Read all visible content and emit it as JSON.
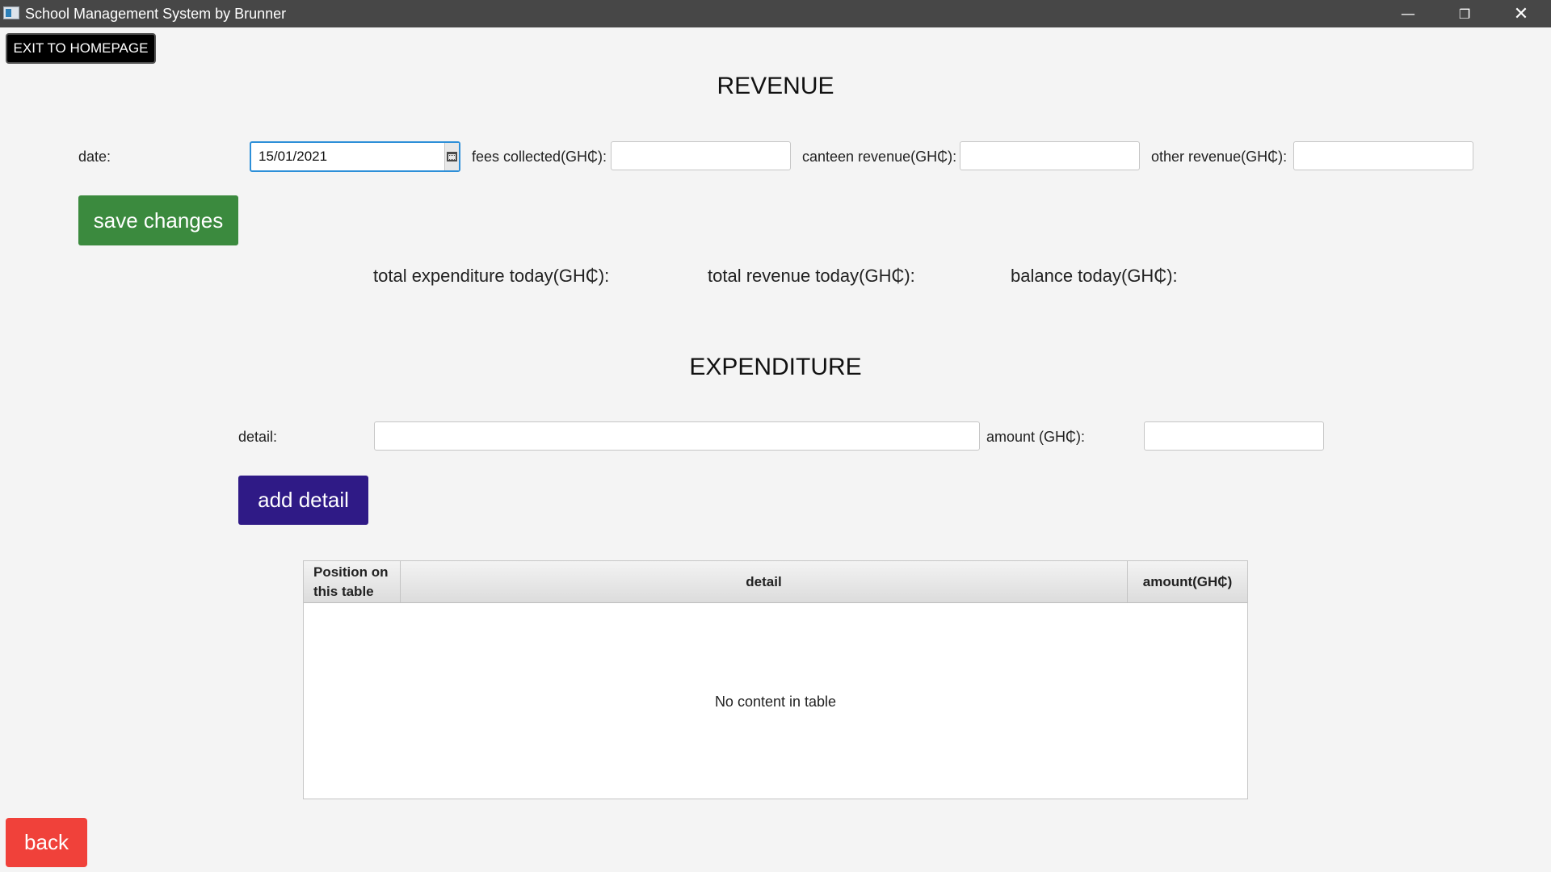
{
  "window": {
    "title": "School Management System by Brunner",
    "minimize_glyph": "—",
    "maximize_glyph": "❐",
    "close_glyph": "✕"
  },
  "nav": {
    "exit_label": "EXIT TO HOMEPAGE",
    "back_label": "back"
  },
  "revenue": {
    "title": "REVENUE",
    "date_label": "date:",
    "date_value": "15/01/2021",
    "fees_label": "fees collected(GH₵):",
    "fees_value": "",
    "canteen_label": "canteen revenue(GH₵):",
    "canteen_value": "",
    "other_label": "other revenue(GH₵):",
    "other_value": "",
    "save_label": "save changes"
  },
  "summary": {
    "total_expenditure_label": "total expenditure today(GH₵):",
    "total_revenue_label": "total revenue today(GH₵):",
    "balance_label": "balance today(GH₵):"
  },
  "expenditure": {
    "title": "EXPENDITURE",
    "detail_label": "detail:",
    "detail_value": "",
    "amount_label": "amount (GH₵):",
    "amount_value": "",
    "add_label": "add detail"
  },
  "table": {
    "columns": [
      "Position on this table",
      "detail",
      "amount(GH₵)"
    ],
    "rows": [],
    "empty_message": "No content in table"
  },
  "colors": {
    "save_button": "#3b8a3e",
    "add_button": "#2f1a86",
    "back_button": "#f0413a",
    "focus_border": "#2d8fd8",
    "titlebar": "#474747"
  }
}
